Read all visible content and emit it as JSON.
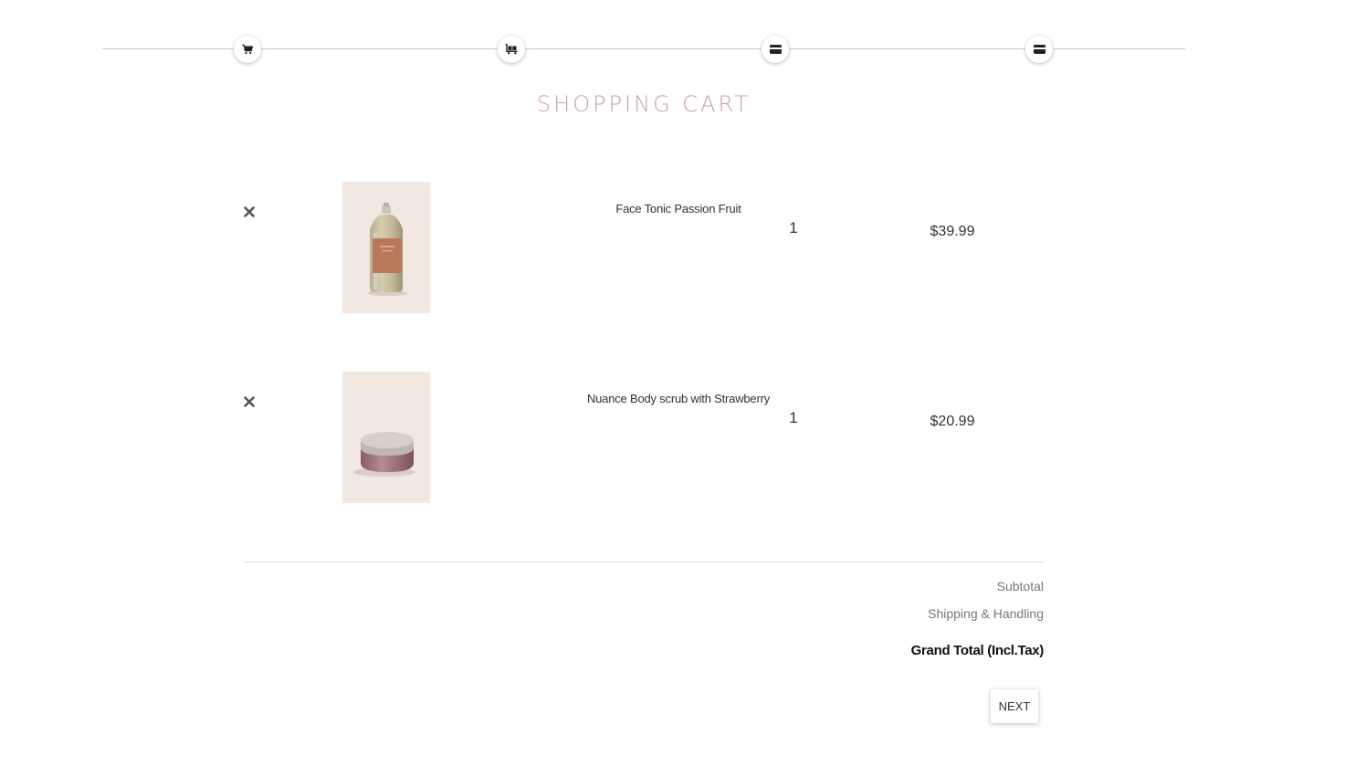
{
  "stepper": {
    "steps": [
      {
        "icon": "cart-icon"
      },
      {
        "icon": "shipping-icon"
      },
      {
        "icon": "credit-card-icon"
      },
      {
        "icon": "credit-card-icon"
      }
    ]
  },
  "page_title": "SHOPPING CART",
  "cart": {
    "items": [
      {
        "name": "Face Tonic Passion Fruit",
        "quantity": "1",
        "price": "$39.99"
      },
      {
        "name": "Nuance Body scrub with Strawberry",
        "quantity": "1",
        "price": "$20.99"
      }
    ]
  },
  "totals": {
    "subtotal_label": "Subtotal",
    "shipping_label": "Shipping & Handling",
    "grand_total_label": "Grand Total (Incl.Tax)"
  },
  "actions": {
    "next_label": "NEXT"
  },
  "colors": {
    "title": "#c9a0a6",
    "thumb_background": "#f1e8e1"
  }
}
